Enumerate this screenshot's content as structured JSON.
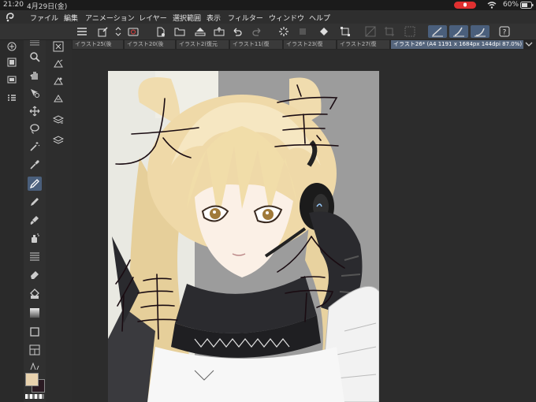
{
  "status_bar": {
    "time": "21:20",
    "date": "4月29日(金)",
    "battery": "60%"
  },
  "menu": {
    "items": [
      "ファイル",
      "編集",
      "アニメーション",
      "レイヤー",
      "選択範囲",
      "表示",
      "フィルター",
      "ウィンドウ",
      "ヘルプ"
    ]
  },
  "tabs": {
    "items": [
      "イラスト25(後",
      "イラスト20(後",
      "イラスト2(復元",
      "イラスト11(復",
      "イラスト23(復",
      "イラスト27(復",
      "イラスト26* (A4 1191 x 1684px 144dpi 87.0%)"
    ],
    "active_index": 6
  },
  "artwork": {
    "handwritten_text": [
      "大",
      "宝",
      "律",
      "令"
    ]
  },
  "colors": {
    "main_color": "#e8d2ae",
    "sub_color": "#2a1a22",
    "accent": "#4a5f7c",
    "record_indicator": "#e03030"
  },
  "icons": {
    "status": [
      "mic-recording-icon",
      "wifi-icon",
      "battery-icon"
    ],
    "command_bar": [
      "menu-icon",
      "new-canvas-icon",
      "stepper-icon",
      "camera-icon",
      "new-file-icon",
      "open-icon",
      "save-icon",
      "export-icon",
      "undo-icon",
      "redo-icon",
      "loading-icon",
      "clear-icon",
      "fill-icon",
      "transform-icon",
      "deselect-icon",
      "pen-stabilizer-icon",
      "pen-sub-icon",
      "pen-line-icon",
      "help-icon"
    ]
  }
}
